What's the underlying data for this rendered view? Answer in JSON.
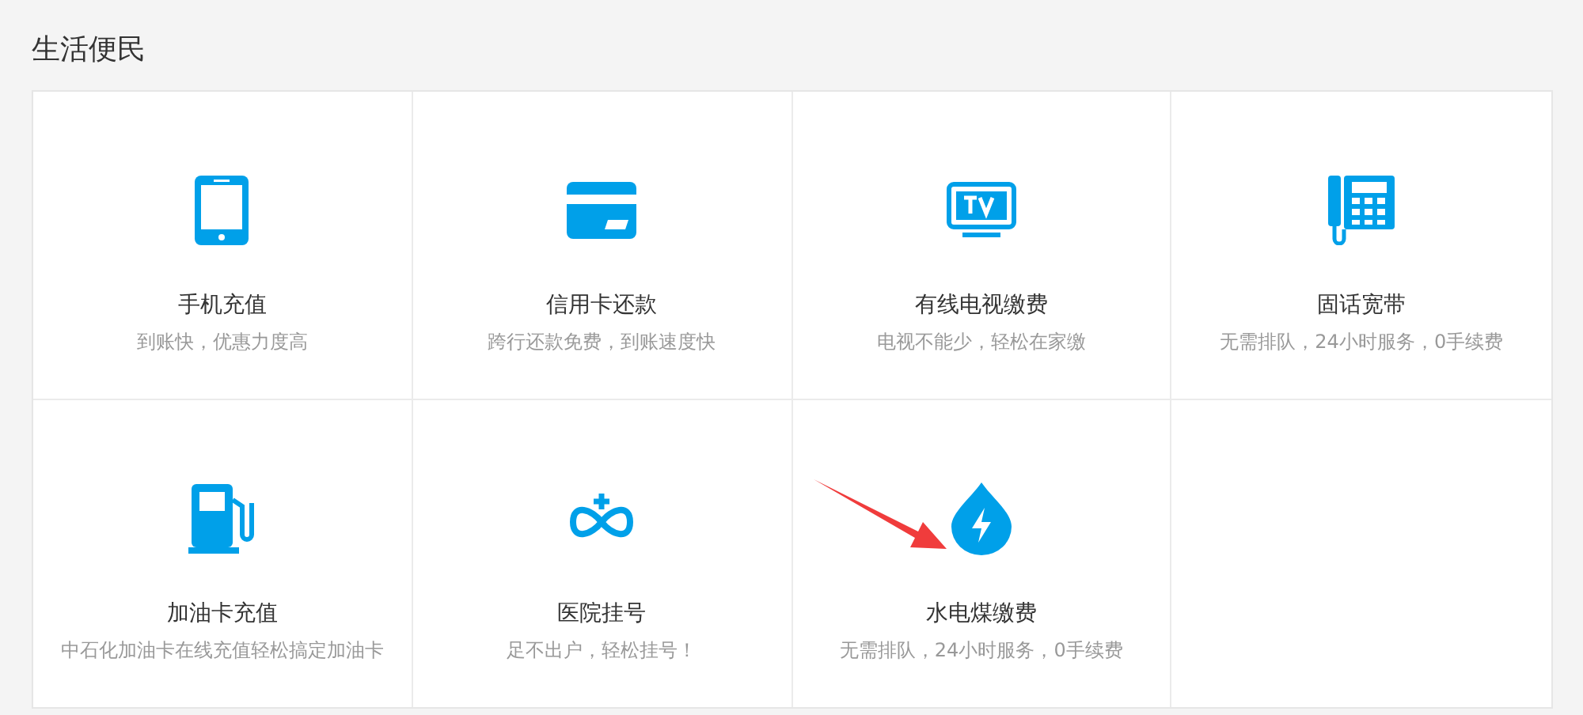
{
  "section_title": "生活便民",
  "services": [
    {
      "kind": "mobile",
      "title": "手机充值",
      "subtitle": "到账快，优惠力度高"
    },
    {
      "kind": "card",
      "title": "信用卡还款",
      "subtitle": "跨行还款免费，到账速度快"
    },
    {
      "kind": "tv",
      "title": "有线电视缴费",
      "subtitle": "电视不能少，轻松在家缴"
    },
    {
      "kind": "landline",
      "title": "固话宽带",
      "subtitle": "无需排队，24小时服务，0手续费"
    },
    {
      "kind": "fuel",
      "title": "加油卡充值",
      "subtitle": "中石化加油卡在线充值轻松搞定加油卡"
    },
    {
      "kind": "hospital",
      "title": "医院挂号",
      "subtitle": "足不出户，轻松挂号！"
    },
    {
      "kind": "utility",
      "title": "水电煤缴费",
      "subtitle": "无需排队，24小时服务，0手续费"
    }
  ]
}
